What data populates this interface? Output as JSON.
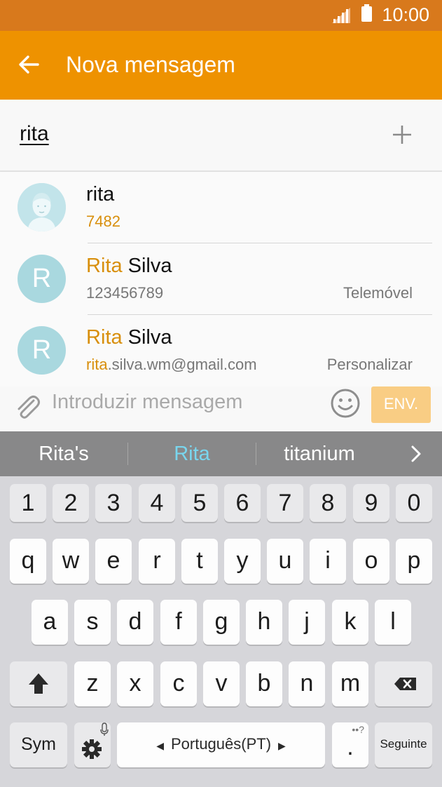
{
  "status_bar": {
    "time": "10:00"
  },
  "app_bar": {
    "title": "Nova mensagem"
  },
  "recipient": {
    "value": "rita"
  },
  "contacts": [
    {
      "name_highlight": "",
      "name_rest": "rita",
      "detail_highlight": "7482",
      "detail_rest": "",
      "type": ""
    },
    {
      "name_highlight": "Rita",
      "name_rest": " Silva",
      "detail_highlight": "",
      "detail_rest": "123456789",
      "type": "Telemóvel"
    },
    {
      "name_highlight": "Rita",
      "name_rest": " Silva",
      "detail_highlight": "rita",
      "detail_rest": ".silva.wm@gmail.com",
      "type": "Personalizar",
      "avatar_letter": "R"
    }
  ],
  "avatars": {
    "letter": "R"
  },
  "compose": {
    "placeholder": "Introduzir mensagem",
    "send_label": "ENV."
  },
  "suggestions": {
    "left": "Rita's",
    "center": "Rita",
    "right": "titanium"
  },
  "keyboard": {
    "row_numbers": [
      "1",
      "2",
      "3",
      "4",
      "5",
      "6",
      "7",
      "8",
      "9",
      "0"
    ],
    "row_q": [
      "q",
      "w",
      "e",
      "r",
      "t",
      "y",
      "u",
      "i",
      "o",
      "p"
    ],
    "row_a": [
      "a",
      "s",
      "d",
      "f",
      "g",
      "h",
      "j",
      "k",
      "l"
    ],
    "row_z": [
      "z",
      "x",
      "c",
      "v",
      "b",
      "n",
      "m"
    ],
    "sym_label": "Sym",
    "space_label": "Português(PT)",
    "period_label": ".",
    "period_alt": "••?",
    "next_label": "Seguinte"
  },
  "colors": {
    "status_bar": "#d8791c",
    "app_bar": "#ee9200",
    "highlight": "#d88f0c",
    "avatar": "#a9d8df",
    "send_disabled": "#f9cd84",
    "suggestion_selected": "#79d6ee"
  }
}
